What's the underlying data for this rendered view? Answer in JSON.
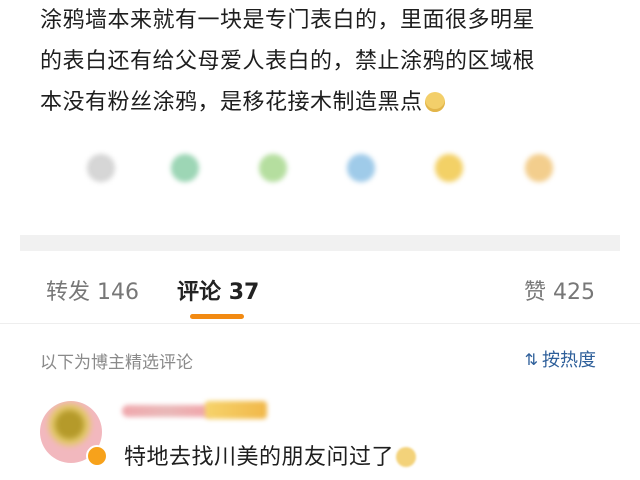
{
  "post": {
    "lines": [
      "涂鸦墙本来就有一块是专门表白的，里面很多明星",
      "的表白还有给父母爱人表白的，禁止涂鸦的区域根",
      "本没有粉丝涂鸦，是移花接木制造黑点"
    ],
    "emoji_icon": "smirk-emoji-icon"
  },
  "share_icons": [
    {
      "name": "share-icon-1",
      "color": "#cfcfcf"
    },
    {
      "name": "share-icon-2",
      "color": "#8ccfa9"
    },
    {
      "name": "share-icon-3",
      "color": "#a9d98f"
    },
    {
      "name": "share-icon-4",
      "color": "#8fc2e6"
    },
    {
      "name": "share-icon-5",
      "color": "#f2c94c"
    },
    {
      "name": "share-icon-6",
      "color": "#f2c67a"
    }
  ],
  "tabs": {
    "repost": {
      "label": "转发",
      "count": "146"
    },
    "comment": {
      "label": "评论",
      "count": "37"
    },
    "like": {
      "label": "赞",
      "count": "425"
    },
    "accent_color": "#f28a12"
  },
  "comments_header": {
    "label": "以下为博主精选评论",
    "sort_label": "按热度",
    "sort_icon": "sort-icon"
  },
  "comment": {
    "text": "特地去找川美的朋友问过了",
    "emoji_icon": "smile-emoji-icon"
  }
}
